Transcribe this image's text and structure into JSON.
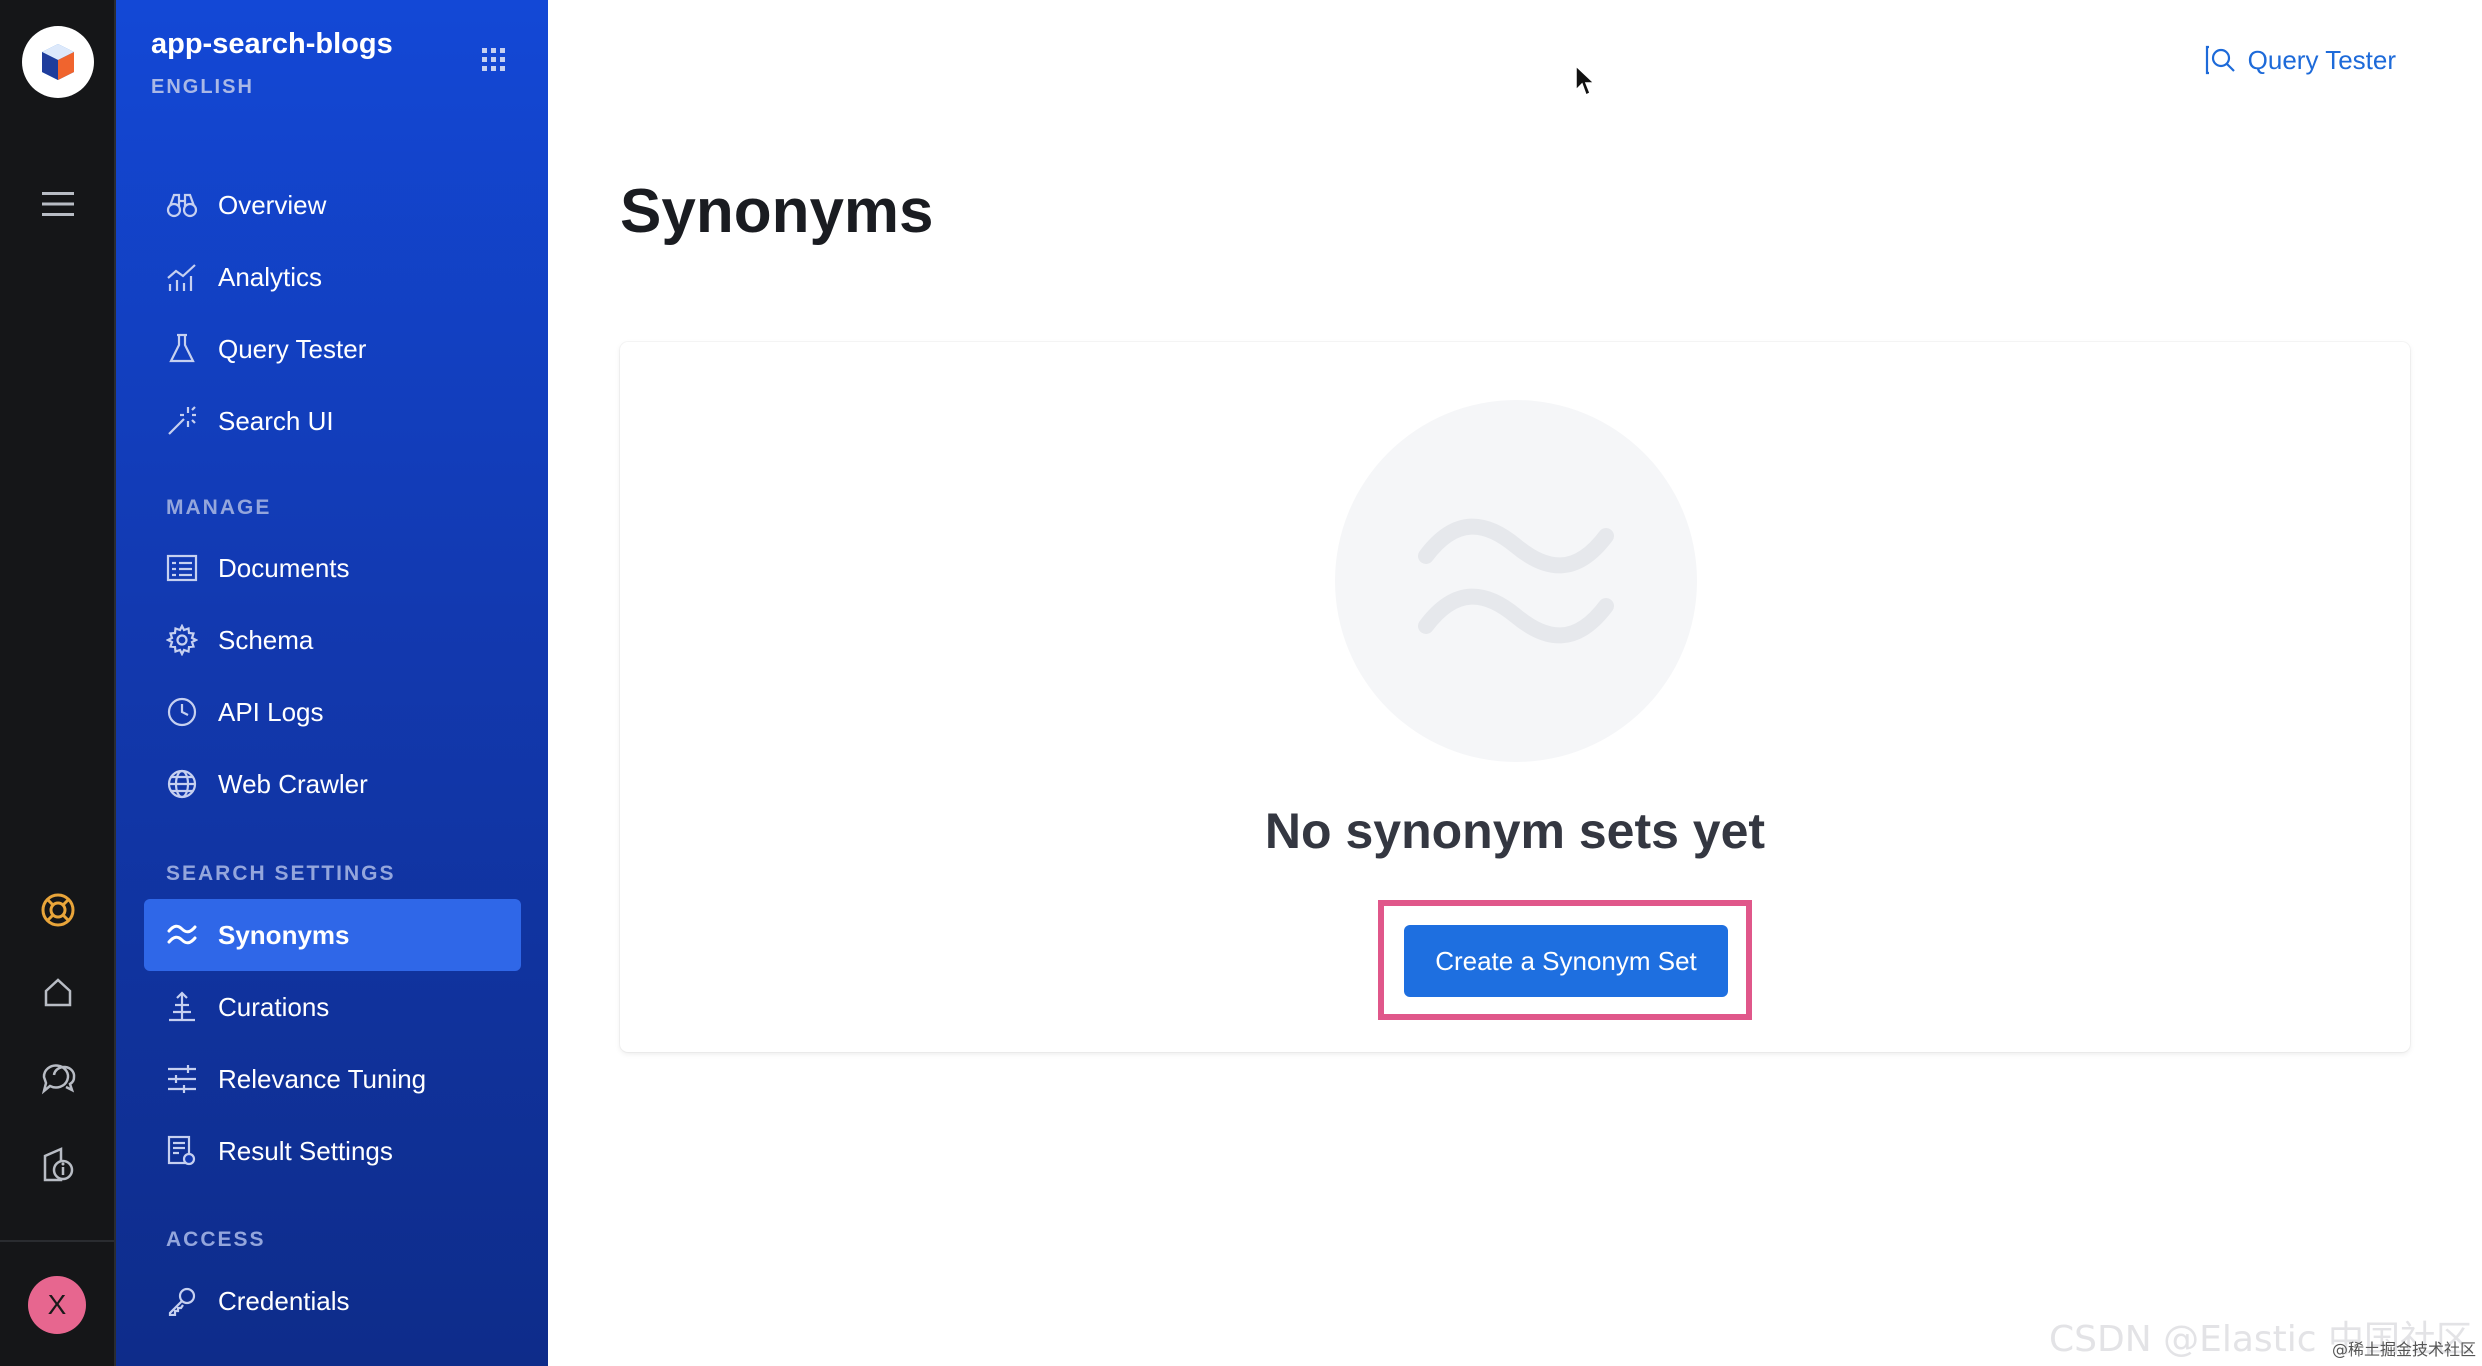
{
  "app": {
    "name": "app-search-blogs",
    "language": "ENGLISH"
  },
  "rail": {
    "avatar_initial": "X"
  },
  "nav": {
    "main_items": [
      {
        "label": "Overview",
        "icon": "binoculars-icon"
      },
      {
        "label": "Analytics",
        "icon": "chart-icon"
      },
      {
        "label": "Query Tester",
        "icon": "beaker-icon"
      },
      {
        "label": "Search UI",
        "icon": "magic-wand-icon"
      }
    ],
    "manage_title": "MANAGE",
    "manage_items": [
      {
        "label": "Documents",
        "icon": "documents-icon"
      },
      {
        "label": "Schema",
        "icon": "gear-icon"
      },
      {
        "label": "API Logs",
        "icon": "clock-icon"
      },
      {
        "label": "Web Crawler",
        "icon": "globe-icon"
      }
    ],
    "search_settings_title": "SEARCH SETTINGS",
    "search_settings_items": [
      {
        "label": "Synonyms",
        "icon": "synonyms-icon",
        "active": true
      },
      {
        "label": "Curations",
        "icon": "curations-icon"
      },
      {
        "label": "Relevance Tuning",
        "icon": "sliders-icon"
      },
      {
        "label": "Result Settings",
        "icon": "result-settings-icon"
      }
    ],
    "access_title": "ACCESS",
    "access_items": [
      {
        "label": "Credentials",
        "icon": "key-icon"
      }
    ]
  },
  "header": {
    "query_tester_link": "Query Tester"
  },
  "main": {
    "title": "Synonyms",
    "empty_title": "No synonym sets yet",
    "cta_label": "Create a Synonym Set"
  },
  "colors": {
    "sidebar_blue": "#1348d6",
    "active_item": "#2f67e8",
    "primary_button": "#1e6fe0",
    "highlight_frame": "#e0578a",
    "link": "#1d6ad9"
  },
  "watermark": {
    "text": "CSDN @Elastic 中国社区",
    "sub": "@稀土掘金技术社区"
  }
}
